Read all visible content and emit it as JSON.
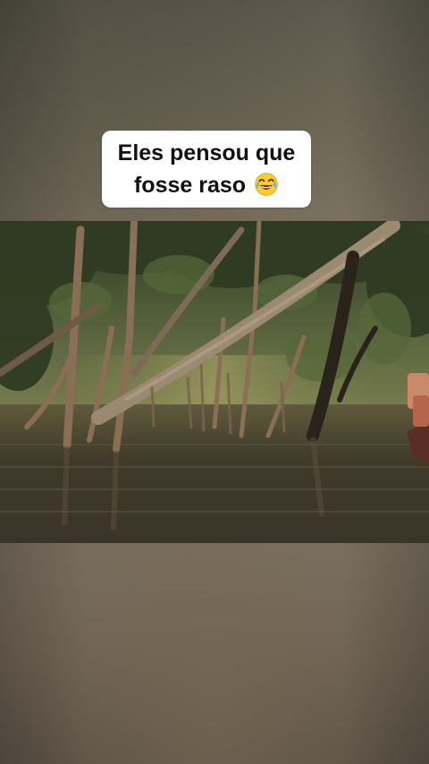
{
  "caption": {
    "line1": "Eles pensou que",
    "line2": "fosse raso",
    "emoji": "face-with-tears-of-joy"
  },
  "video": {
    "scene": "flooded-mangrove-forest"
  },
  "colors": {
    "caption_bg": "#ffffff",
    "caption_text": "#111111",
    "background": "#6e6456",
    "water": "#3a3a2a",
    "foliage": "#4d5a34"
  }
}
